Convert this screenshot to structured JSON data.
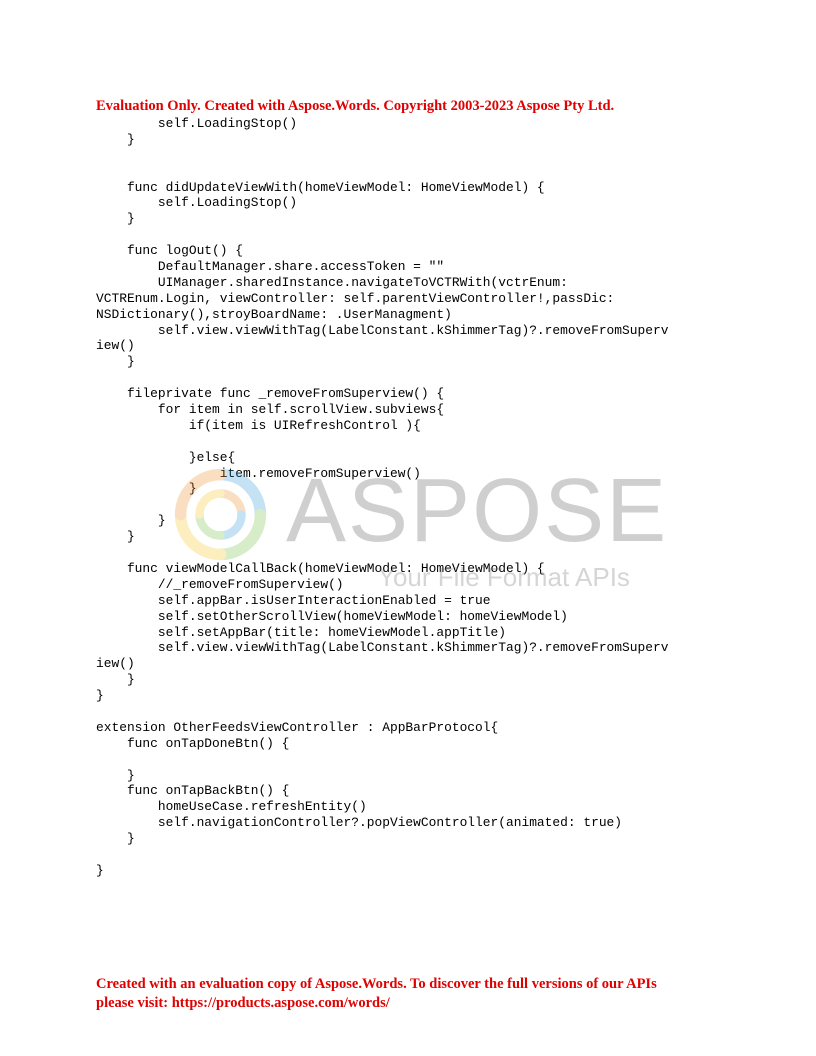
{
  "header_notice": "Evaluation Only. Created with Aspose.Words. Copyright 2003-2023 Aspose Pty Ltd.",
  "code_lines": [
    "        self.LoadingStop()",
    "    }",
    "",
    "",
    "    func didUpdateViewWith(homeViewModel: HomeViewModel) {",
    "        self.LoadingStop()",
    "    }",
    "",
    "    func logOut() {",
    "        DefaultManager.share.accessToken = \"\"",
    "        UIManager.sharedInstance.navigateToVCTRWith(vctrEnum:",
    "VCTREnum.Login, viewController: self.parentViewController!,passDic:",
    "NSDictionary(),stroyBoardName: .UserManagment)",
    "        self.view.viewWithTag(LabelConstant.kShimmerTag)?.removeFromSuperv",
    "iew()",
    "    }",
    "",
    "    fileprivate func _removeFromSuperview() {",
    "        for item in self.scrollView.subviews{",
    "            if(item is UIRefreshControl ){",
    "",
    "            }else{",
    "                item.removeFromSuperview()",
    "            }",
    "",
    "        }",
    "    }",
    "",
    "    func viewModelCallBack(homeViewModel: HomeViewModel) {",
    "        //_removeFromSuperview()",
    "        self.appBar.isUserInteractionEnabled = true",
    "        self.setOtherScrollView(homeViewModel: homeViewModel)",
    "        self.setAppBar(title: homeViewModel.appTitle)",
    "        self.view.viewWithTag(LabelConstant.kShimmerTag)?.removeFromSuperv",
    "iew()",
    "    }",
    "}",
    "",
    "extension OtherFeedsViewController : AppBarProtocol{",
    "    func onTapDoneBtn() {",
    "",
    "    }",
    "    func onTapBackBtn() {",
    "        homeUseCase.refreshEntity()",
    "        self.navigationController?.popViewController(animated: true)",
    "    }",
    "",
    "}"
  ],
  "watermark": {
    "brand": "ASPOSE",
    "tagline": "Your File Format APIs"
  },
  "footer_notice": {
    "line1": "Created with an evaluation copy of Aspose.Words. To discover the full versions of our APIs",
    "line2": "please visit: https://products.aspose.com/words/"
  },
  "colors": {
    "notice_red": "#e00000",
    "code_text": "#000000",
    "watermark_gray": "#555555"
  }
}
